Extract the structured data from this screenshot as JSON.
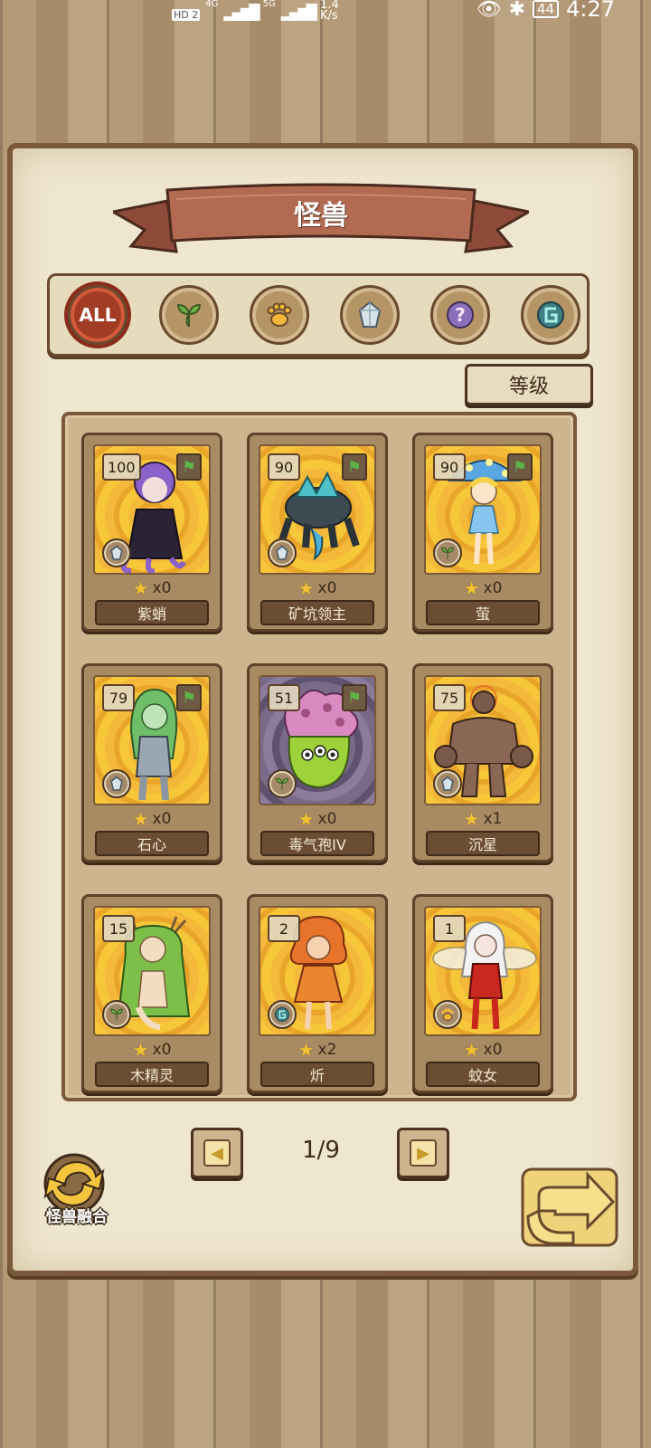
{
  "status_bar": {
    "hd_label": "HD",
    "hd_num": "2",
    "net1": "4G",
    "net2": "5G",
    "speed_value": "1.4",
    "speed_unit": "K/s",
    "battery": "44",
    "time": "4:27"
  },
  "title": "怪兽",
  "filters": [
    {
      "label": "ALL",
      "icon": "all-badge",
      "active": true
    },
    {
      "icon": "leaf-icon"
    },
    {
      "icon": "paw-icon"
    },
    {
      "icon": "crystal-icon"
    },
    {
      "icon": "question-icon"
    },
    {
      "icon": "rune-icon"
    }
  ],
  "sort_label": "等级",
  "monsters": [
    {
      "name": "紫蛸",
      "level": "100",
      "count": "x0",
      "type_icon": "crystal-icon",
      "flag": true
    },
    {
      "name": "矿坑领主",
      "level": "90",
      "count": "x0",
      "type_icon": "crystal-icon",
      "flag": true
    },
    {
      "name": "萤",
      "level": "90",
      "count": "x0",
      "type_icon": "leaf-icon",
      "flag": true
    },
    {
      "name": "石心",
      "level": "79",
      "count": "x0",
      "type_icon": "crystal-icon",
      "flag": true
    },
    {
      "name": "毒气孢IV",
      "level": "51",
      "count": "x0",
      "type_icon": "leaf-icon",
      "flag": true
    },
    {
      "name": "沉星",
      "level": "75",
      "count": "x1",
      "type_icon": "crystal-icon",
      "flag": false
    },
    {
      "name": "木精灵",
      "level": "15",
      "count": "x0",
      "type_icon": "leaf-icon",
      "flag": false
    },
    {
      "name": "炘",
      "level": "2",
      "count": "x2",
      "type_icon": "rune-icon",
      "flag": false
    },
    {
      "name": "蚊女",
      "level": "1",
      "count": "x0",
      "type_icon": "paw-icon",
      "flag": false
    }
  ],
  "pagination": {
    "text": "1/9"
  },
  "fusion_label": "怪兽融合"
}
